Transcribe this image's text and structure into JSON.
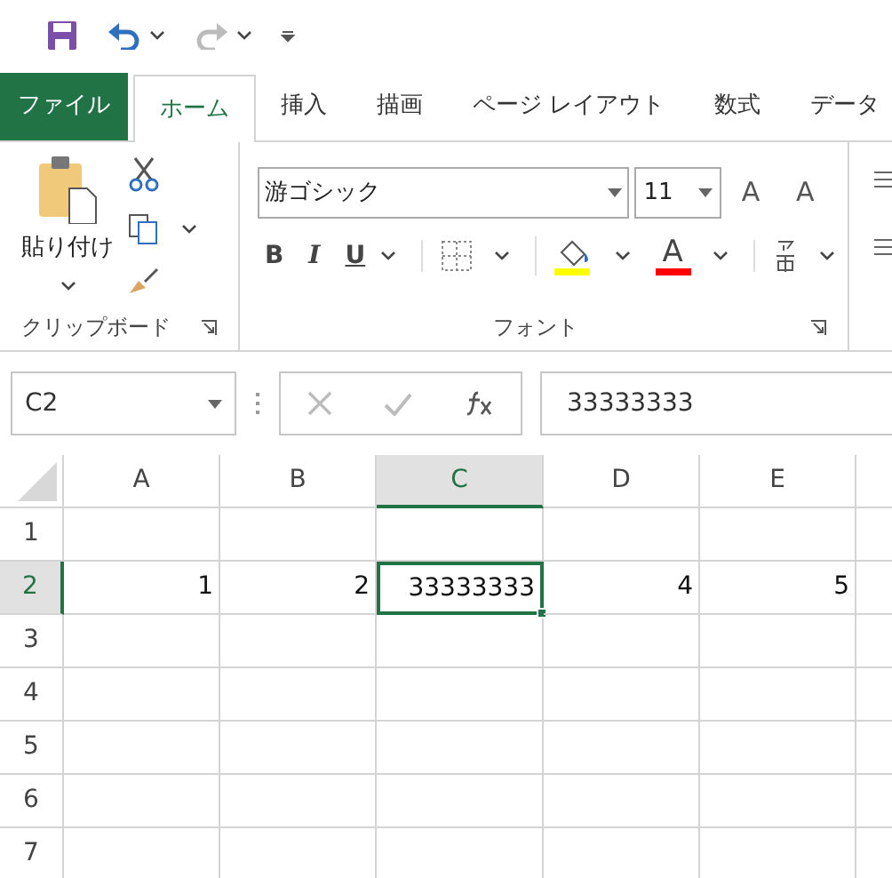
{
  "quick_access": {
    "undo_disabled": false,
    "redo_disabled": true
  },
  "tabs": [
    {
      "label": "ファイル",
      "kind": "file",
      "selected": false
    },
    {
      "label": "ホーム",
      "kind": "tab",
      "selected": true
    },
    {
      "label": "挿入",
      "kind": "tab",
      "selected": false
    },
    {
      "label": "描画",
      "kind": "tab",
      "selected": false
    },
    {
      "label": "ページ レイアウト",
      "kind": "tab",
      "selected": false
    },
    {
      "label": "数式",
      "kind": "tab",
      "selected": false
    },
    {
      "label": "データ",
      "kind": "tab",
      "selected": false
    }
  ],
  "clipboard": {
    "paste_label": "貼り付け",
    "group_label": "クリップボード"
  },
  "font_group": {
    "font_name": "游ゴシック",
    "font_size": "11",
    "grow_label": "A",
    "shrink_label": "A",
    "bold_label": "B",
    "italic_label": "I",
    "underline_label": "U",
    "font_color_label": "A",
    "group_label": "フォント"
  },
  "formula_bar": {
    "name_box": "C2",
    "content": "33333333"
  },
  "sheet": {
    "columns": [
      {
        "label": "A",
        "selected": false
      },
      {
        "label": "B",
        "selected": false
      },
      {
        "label": "C",
        "selected": true
      },
      {
        "label": "D",
        "selected": false
      },
      {
        "label": "E",
        "selected": false
      }
    ],
    "rows": [
      {
        "label": "1",
        "selected": false
      },
      {
        "label": "2",
        "selected": true,
        "cells": [
          {
            "value": "1",
            "selected": false
          },
          {
            "value": "2",
            "selected": false
          },
          {
            "value": "33333333",
            "selected": true
          },
          {
            "value": "4",
            "selected": false
          },
          {
            "value": "5",
            "selected": false
          }
        ]
      },
      {
        "label": "3",
        "selected": false
      },
      {
        "label": "4",
        "selected": false
      },
      {
        "label": "5",
        "selected": false
      },
      {
        "label": "6",
        "selected": false
      },
      {
        "label": "7",
        "selected": false
      }
    ]
  }
}
